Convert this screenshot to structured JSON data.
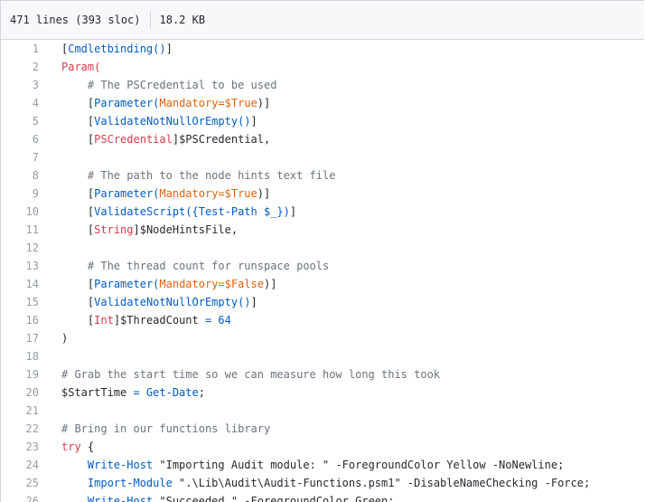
{
  "file_info": {
    "lines": "471 lines (393 sloc)",
    "size": "18.2 KB"
  },
  "code_lines": [
    {
      "num": "1",
      "indent": "",
      "tokens": [
        {
          "t": "[",
          "c": "plain"
        },
        {
          "t": "Cmdletbinding()",
          "c": "blue"
        },
        {
          "t": "]",
          "c": "plain"
        }
      ]
    },
    {
      "num": "2",
      "indent": "",
      "tokens": [
        {
          "t": "Param(",
          "c": "red"
        }
      ]
    },
    {
      "num": "3",
      "indent": "    ",
      "tokens": [
        {
          "t": "# The PSCredential to be used",
          "c": "gray"
        }
      ]
    },
    {
      "num": "4",
      "indent": "    ",
      "tokens": [
        {
          "t": "[",
          "c": "plain"
        },
        {
          "t": "Parameter(",
          "c": "blue"
        },
        {
          "t": "Mandatory=$True",
          "c": "orange"
        },
        {
          "t": ")]",
          "c": "plain"
        }
      ]
    },
    {
      "num": "5",
      "indent": "    ",
      "tokens": [
        {
          "t": "[",
          "c": "plain"
        },
        {
          "t": "ValidateNotNullOrEmpty()",
          "c": "blue"
        },
        {
          "t": "]",
          "c": "plain"
        }
      ]
    },
    {
      "num": "6",
      "indent": "    ",
      "tokens": [
        {
          "t": "[",
          "c": "plain"
        },
        {
          "t": "PSCredential",
          "c": "red"
        },
        {
          "t": "]$PSCredential,",
          "c": "plain"
        }
      ]
    },
    {
      "num": "7",
      "indent": "",
      "tokens": []
    },
    {
      "num": "8",
      "indent": "    ",
      "tokens": [
        {
          "t": "# The path to the node hints text file",
          "c": "gray"
        }
      ]
    },
    {
      "num": "9",
      "indent": "    ",
      "tokens": [
        {
          "t": "[",
          "c": "plain"
        },
        {
          "t": "Parameter(",
          "c": "blue"
        },
        {
          "t": "Mandatory=$True",
          "c": "orange"
        },
        {
          "t": ")]",
          "c": "plain"
        }
      ]
    },
    {
      "num": "10",
      "indent": "    ",
      "tokens": [
        {
          "t": "[",
          "c": "plain"
        },
        {
          "t": "ValidateScript({Test-Path $_})",
          "c": "blue"
        },
        {
          "t": "]",
          "c": "plain"
        }
      ]
    },
    {
      "num": "11",
      "indent": "    ",
      "tokens": [
        {
          "t": "[",
          "c": "plain"
        },
        {
          "t": "String",
          "c": "red"
        },
        {
          "t": "]$NodeHintsFile,",
          "c": "plain"
        }
      ]
    },
    {
      "num": "12",
      "indent": "",
      "tokens": []
    },
    {
      "num": "13",
      "indent": "    ",
      "tokens": [
        {
          "t": "# The thread count for runspace pools",
          "c": "gray"
        }
      ]
    },
    {
      "num": "14",
      "indent": "    ",
      "tokens": [
        {
          "t": "[",
          "c": "plain"
        },
        {
          "t": "Parameter(",
          "c": "blue"
        },
        {
          "t": "Mandatory=$False",
          "c": "orange"
        },
        {
          "t": ")]",
          "c": "plain"
        }
      ]
    },
    {
      "num": "15",
      "indent": "    ",
      "tokens": [
        {
          "t": "[",
          "c": "plain"
        },
        {
          "t": "ValidateNotNullOrEmpty()",
          "c": "blue"
        },
        {
          "t": "]",
          "c": "plain"
        }
      ]
    },
    {
      "num": "16",
      "indent": "    ",
      "tokens": [
        {
          "t": "[",
          "c": "plain"
        },
        {
          "t": "Int",
          "c": "red"
        },
        {
          "t": "]$ThreadCount ",
          "c": "plain"
        },
        {
          "t": "= 64",
          "c": "blue"
        }
      ]
    },
    {
      "num": "17",
      "indent": "",
      "tokens": [
        {
          "t": ")",
          "c": "plain"
        }
      ]
    },
    {
      "num": "18",
      "indent": "",
      "tokens": []
    },
    {
      "num": "19",
      "indent": "",
      "tokens": [
        {
          "t": "# Grab the start time so we can measure how long this took",
          "c": "gray"
        }
      ]
    },
    {
      "num": "20",
      "indent": "",
      "tokens": [
        {
          "t": "$StartTime ",
          "c": "plain"
        },
        {
          "t": "= Get-Date",
          "c": "blue"
        },
        {
          "t": ";",
          "c": "plain"
        }
      ]
    },
    {
      "num": "21",
      "indent": "",
      "tokens": []
    },
    {
      "num": "22",
      "indent": "",
      "tokens": [
        {
          "t": "# Bring in our functions library",
          "c": "gray"
        }
      ]
    },
    {
      "num": "23",
      "indent": "",
      "tokens": [
        {
          "t": "try",
          "c": "red"
        },
        {
          "t": " {",
          "c": "plain"
        }
      ]
    },
    {
      "num": "24",
      "indent": "    ",
      "tokens": [
        {
          "t": "Write-Host",
          "c": "blue"
        },
        {
          "t": " \"Importing Audit module: \" -ForegroundColor Yellow -NoNewline;",
          "c": "plain"
        }
      ]
    },
    {
      "num": "25",
      "indent": "    ",
      "tokens": [
        {
          "t": "Import-Module",
          "c": "blue"
        },
        {
          "t": " \".\\Lib\\Audit\\Audit-Functions.psm1\" -DisableNameChecking -Force;",
          "c": "plain"
        }
      ]
    },
    {
      "num": "26",
      "indent": "    ",
      "tokens": [
        {
          "t": "Write-Host",
          "c": "blue"
        },
        {
          "t": " \"Succeeded.\" -ForegroundColor Green;",
          "c": "plain"
        }
      ]
    }
  ]
}
